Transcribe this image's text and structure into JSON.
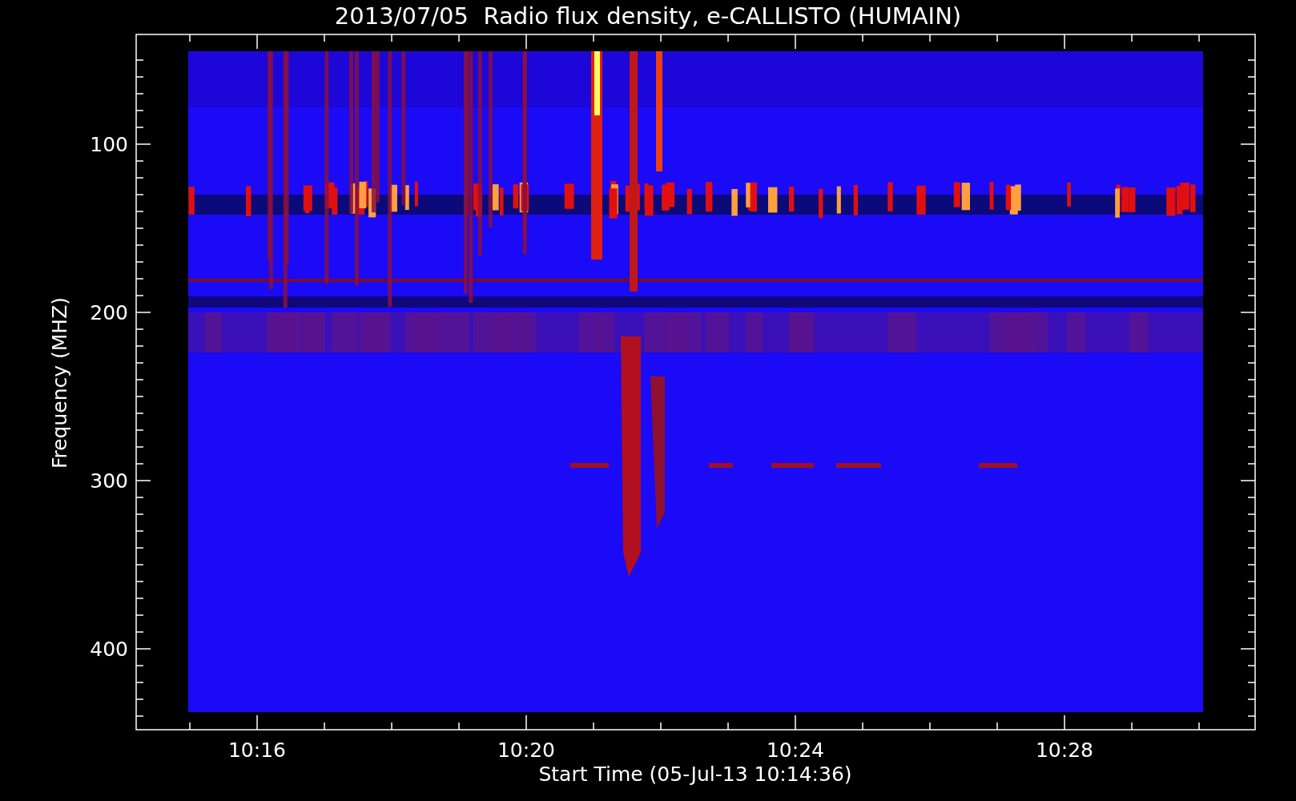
{
  "title": "2013/07/05  Radio flux density, e-CALLISTO (HUMAIN)",
  "y_axis": {
    "title": "Frequency (MHZ)",
    "tick_labels": [
      "100",
      "200",
      "300",
      "400"
    ]
  },
  "x_axis": {
    "title": "Start Time (05-Jul-13 10:14:36)",
    "tick_labels": [
      "10:16",
      "10:20",
      "10:24",
      "10:28"
    ]
  }
}
